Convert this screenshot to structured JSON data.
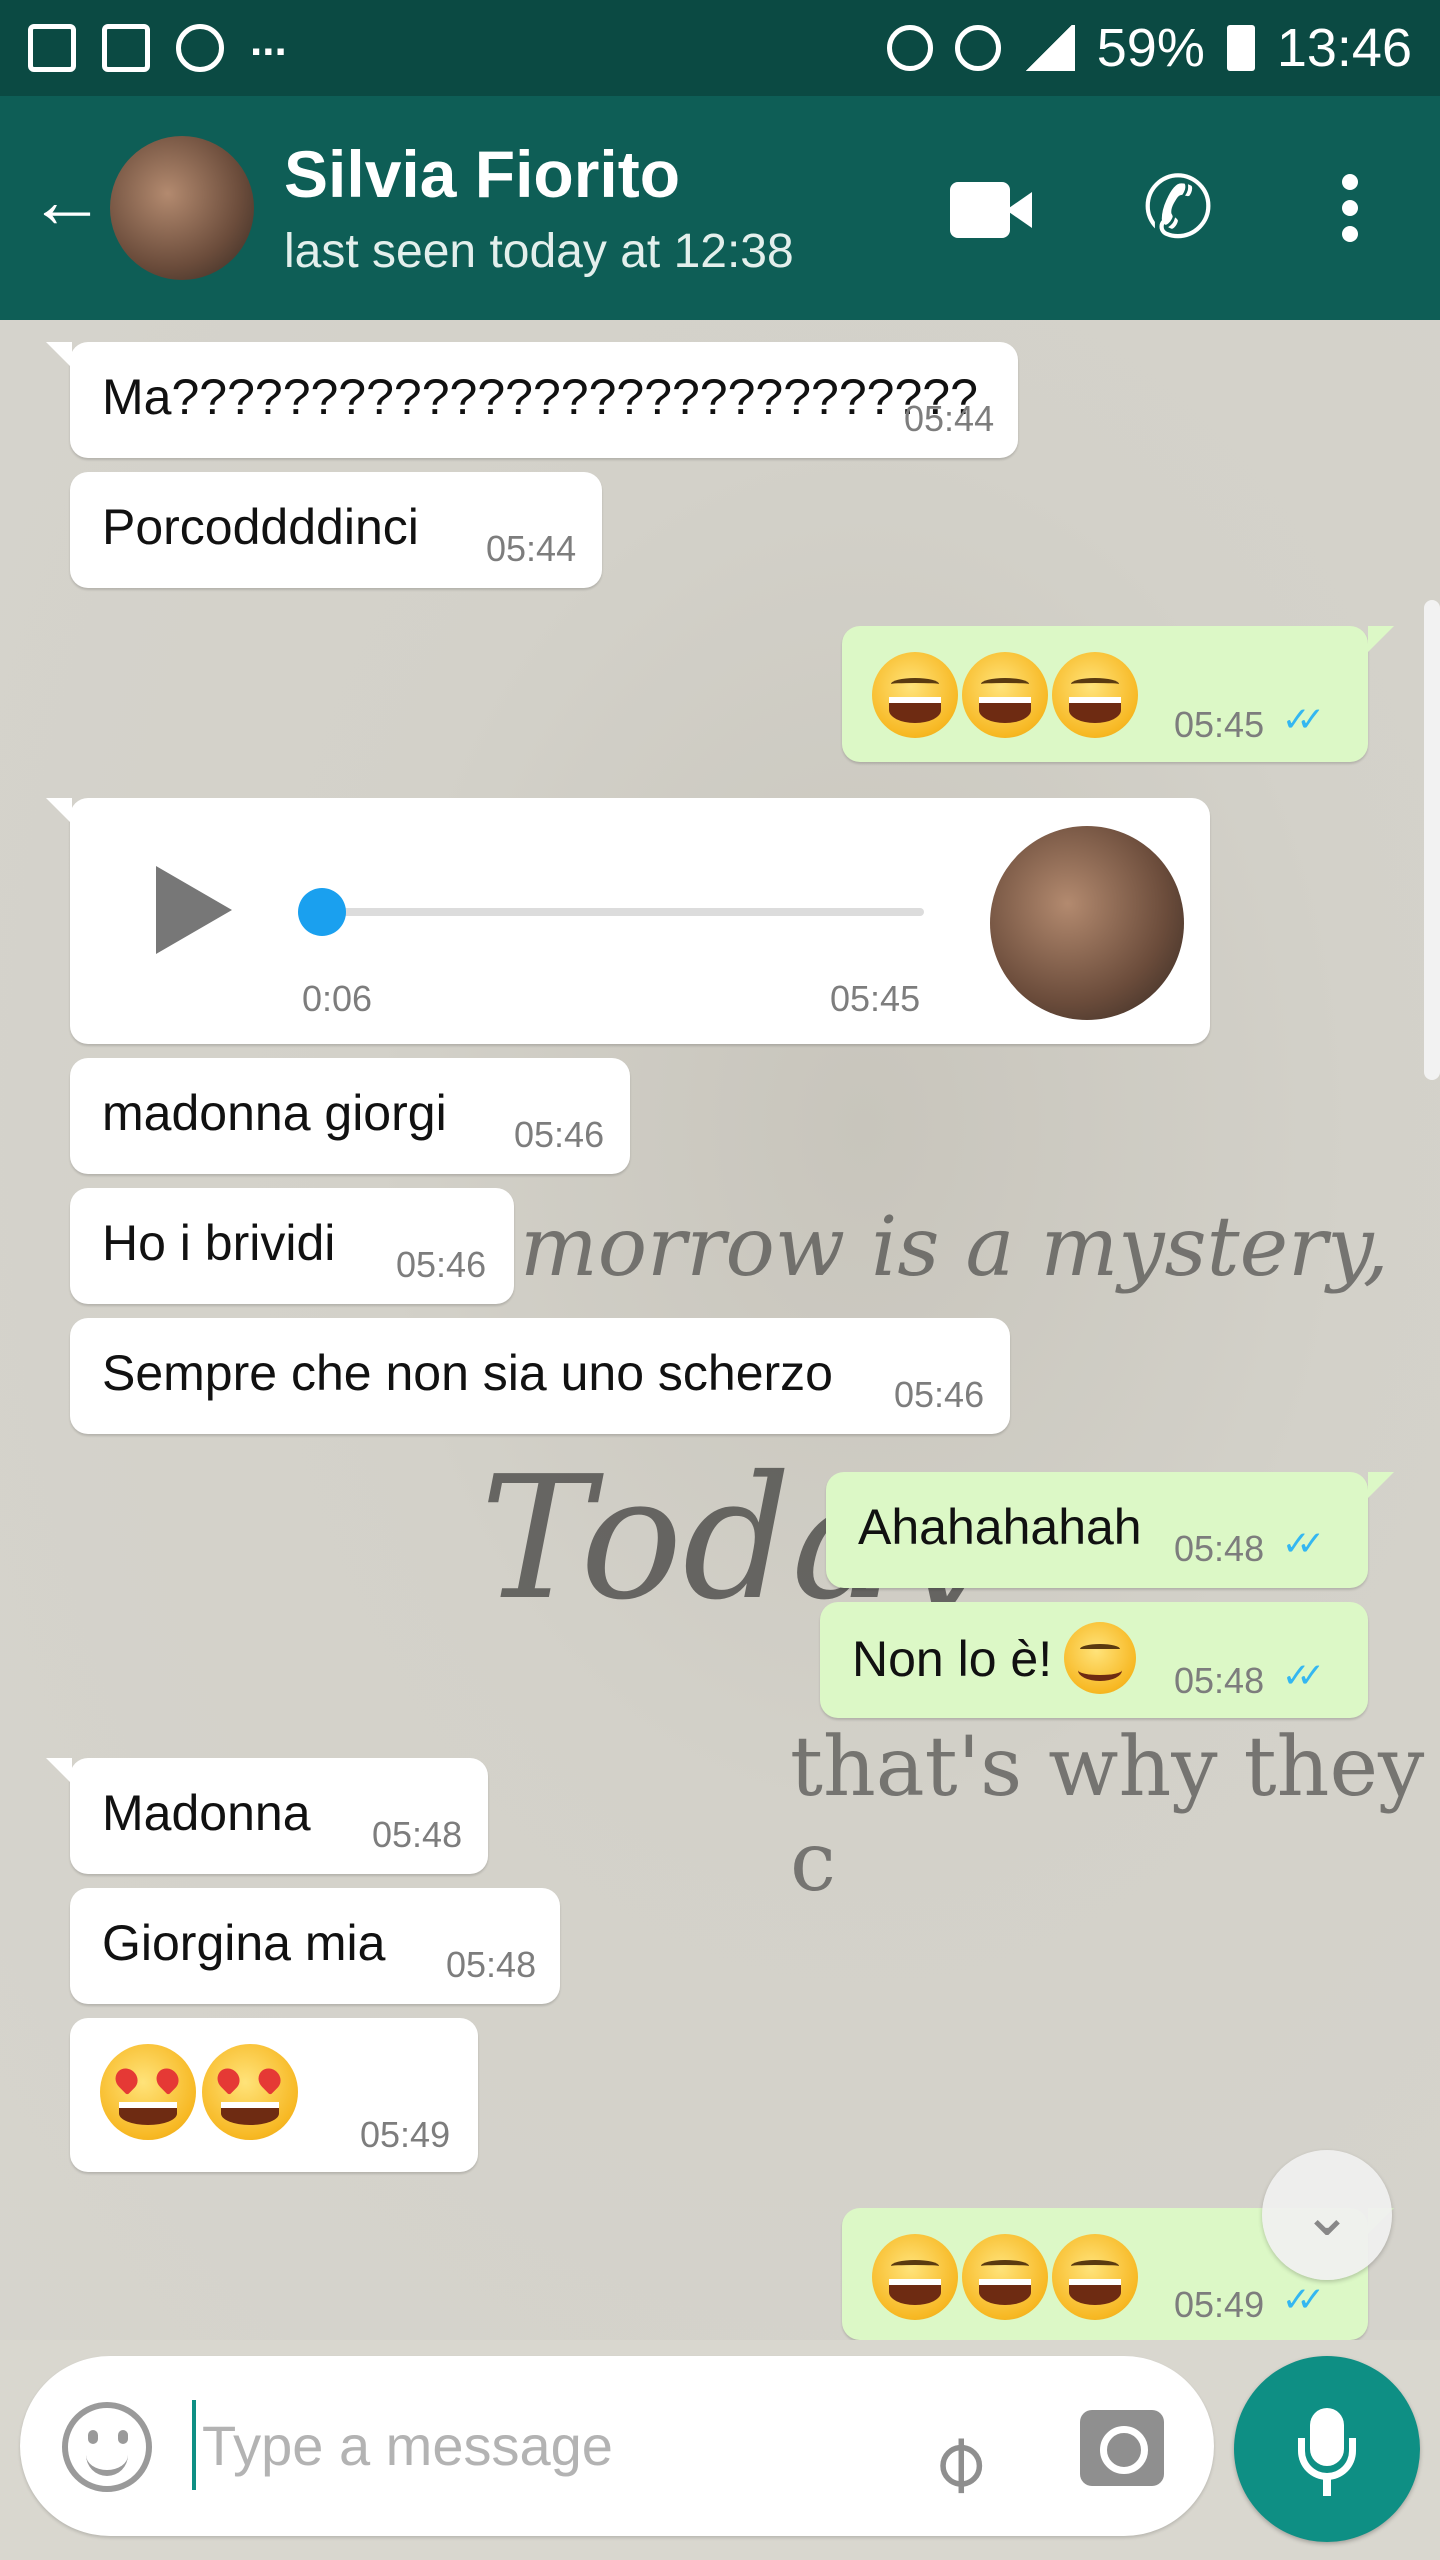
{
  "status_bar": {
    "battery": "59%",
    "time": "13:46",
    "dots": "..."
  },
  "header": {
    "contact_name": "Silvia Fiorito",
    "last_seen": "last seen today at 12:38"
  },
  "messages": [
    {
      "dir": "in",
      "text": "Ma?????????????????????????????",
      "time": "05:44"
    },
    {
      "dir": "in",
      "text": "Porcoddddinci",
      "time": "05:44"
    },
    {
      "dir": "out",
      "emoji": [
        "laughing-tears",
        "grin",
        "sweat-smile"
      ],
      "time": "05:45",
      "ticks": "read"
    },
    {
      "dir": "in",
      "type": "voice",
      "duration": "0:06",
      "time": "05:45",
      "progress": 0
    },
    {
      "dir": "in",
      "text": "madonna giorgi",
      "time": "05:46"
    },
    {
      "dir": "in",
      "text": "Ho i brividi",
      "time": "05:46"
    },
    {
      "dir": "in",
      "text": "Sempre che non sia uno scherzo",
      "time": "05:46"
    },
    {
      "dir": "out",
      "text": "Ahahahahah",
      "time": "05:48",
      "ticks": "read"
    },
    {
      "dir": "out",
      "text": "Non lo è!",
      "emoji": [
        "blush"
      ],
      "time": "05:48",
      "ticks": "read"
    },
    {
      "dir": "in",
      "text": "Madonna",
      "time": "05:48"
    },
    {
      "dir": "in",
      "text": "Giorgina mia",
      "time": "05:48"
    },
    {
      "dir": "in",
      "emoji": [
        "heart-eyes",
        "heart-eyes"
      ],
      "time": "05:49"
    },
    {
      "dir": "out",
      "emoji": [
        "laughing-tears",
        "laughing-tears",
        "laughing-tears"
      ],
      "time": "05:49",
      "ticks": "read"
    }
  ],
  "wallpaper": {
    "line1": "morrow is a mystery,",
    "line2": "Today",
    "line3": "that's why they c"
  },
  "composer": {
    "placeholder": "Type a message"
  },
  "colors": {
    "header": "#0e5e56",
    "status_bar": "#0b4a43",
    "outgoing_bubble": "#dcf8c6",
    "incoming_bubble": "#ffffff",
    "read_tick": "#34b7f1",
    "fab": "#0e8f84"
  }
}
